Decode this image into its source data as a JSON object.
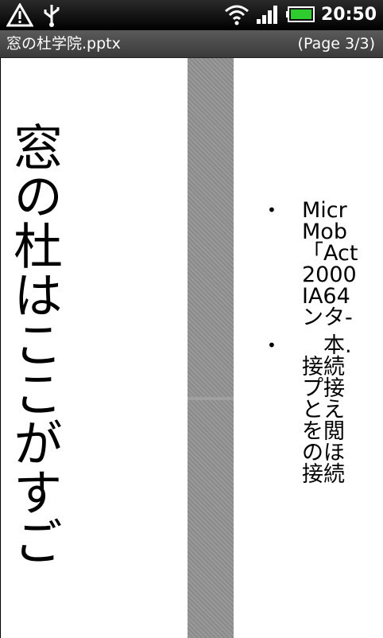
{
  "status_bar": {
    "clock": "20:50",
    "icons": [
      "warning-icon",
      "usb-icon",
      "wifi-icon",
      "signal-icon",
      "battery-icon"
    ],
    "battery_color": "#2ecc2e"
  },
  "title_bar": {
    "file_name": "窓の杜学院.pptx",
    "page_indicator": "(Page 3/3)"
  },
  "slide_left": {
    "vertical_title": "窓の杜はここがすご"
  },
  "slide_right": {
    "bullets": [
      {
        "lines": [
          "Micr",
          "Mob",
          "「Act",
          "2000",
          "IA64",
          "ンタ-"
        ]
      },
      {
        "lines": [
          "　本.",
          "接続",
          "プ接",
          "とえ",
          "を閲",
          "のほ",
          "接続"
        ]
      }
    ]
  }
}
